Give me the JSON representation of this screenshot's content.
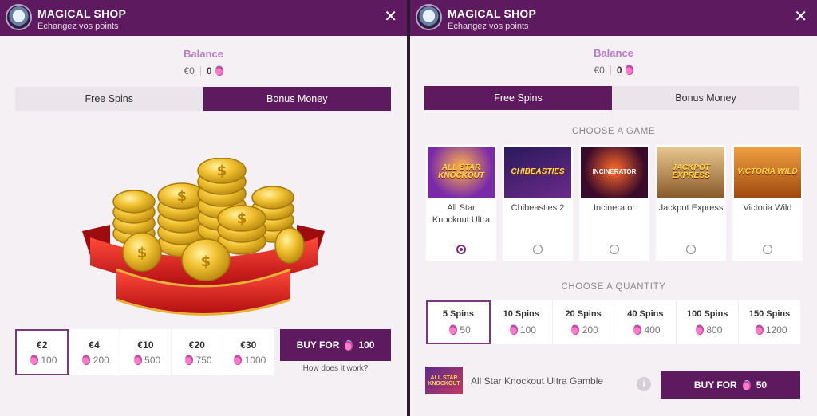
{
  "left": {
    "header": {
      "title": "MAGICAL SHOP",
      "subtitle": "Echangez vos points",
      "close_label": "✕"
    },
    "balance": {
      "title": "Balance",
      "money": "€0",
      "points": "0"
    },
    "tabs": [
      {
        "label": "Free Spins",
        "active": false
      },
      {
        "label": "Bonus Money",
        "active": true
      }
    ],
    "packages": [
      {
        "amount": "€2",
        "cost": "100",
        "selected": true
      },
      {
        "amount": "€4",
        "cost": "200",
        "selected": false
      },
      {
        "amount": "€10",
        "cost": "500",
        "selected": false
      },
      {
        "amount": "€20",
        "cost": "750",
        "selected": false
      },
      {
        "amount": "€30",
        "cost": "1000",
        "selected": false
      }
    ],
    "buy": {
      "label": "BUY FOR",
      "cost": "100"
    },
    "how_link": "How does it work?"
  },
  "right": {
    "header": {
      "title": "MAGICAL SHOP",
      "subtitle": "Echangez vos points",
      "close_label": "✕"
    },
    "balance": {
      "title": "Balance",
      "money": "€0",
      "points": "0"
    },
    "tabs": [
      {
        "label": "Free Spins",
        "active": true
      },
      {
        "label": "Bonus Money",
        "active": false
      }
    ],
    "choose_game_label": "CHOOSE A GAME",
    "games": [
      {
        "name": "All Star Knockout Ultra",
        "thumb_text": "ALL STAR KNOCKOUT",
        "selected": true
      },
      {
        "name": "Chibeasties 2",
        "thumb_text": "CHIBEASTIES",
        "selected": false
      },
      {
        "name": "Incinerator",
        "thumb_text": "INCINERATOR",
        "selected": false
      },
      {
        "name": "Jackpot Express",
        "thumb_text": "JACKPOT EXPRESS",
        "selected": false
      },
      {
        "name": "Victoria Wild",
        "thumb_text": "VICTORIA WILD",
        "selected": false
      }
    ],
    "choose_quantity_label": "CHOOSE A QUANTITY",
    "quantities": [
      {
        "spins": "5 Spins",
        "cost": "50",
        "selected": true
      },
      {
        "spins": "10 Spins",
        "cost": "100",
        "selected": false
      },
      {
        "spins": "20 Spins",
        "cost": "200",
        "selected": false
      },
      {
        "spins": "40 Spins",
        "cost": "400",
        "selected": false
      },
      {
        "spins": "100 Spins",
        "cost": "800",
        "selected": false
      },
      {
        "spins": "150 Spins",
        "cost": "1200",
        "selected": false
      }
    ],
    "summary": {
      "game": "All Star Knockout Ultra Gamble",
      "thumb_text": "ALL STAR KNOCKOUT",
      "info": "i"
    },
    "buy": {
      "label": "BUY FOR",
      "cost": "50"
    }
  },
  "colors": {
    "brand": "#5e1a5e",
    "accent": "#b77cc6",
    "panel_bg": "#f4f0f4"
  },
  "icons": {
    "logo": "magic-ball-icon",
    "close": "close-icon",
    "currency": "potion-icon",
    "info": "info-icon"
  }
}
